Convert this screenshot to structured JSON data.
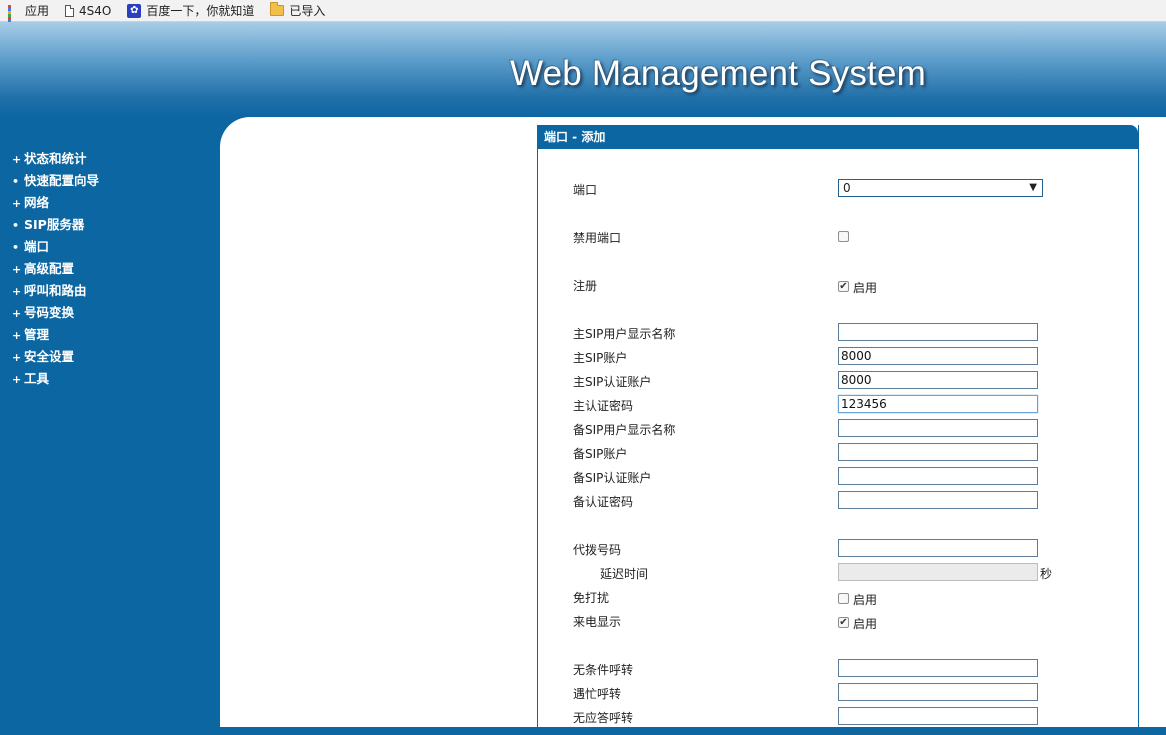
{
  "bookmarks": [
    {
      "label": "应用",
      "icon": "apps-icon"
    },
    {
      "label": "4S4O",
      "icon": "page-icon"
    },
    {
      "label": "百度一下，你就知道",
      "icon": "baidu-paw-icon"
    },
    {
      "label": "已导入",
      "icon": "folder-icon"
    }
  ],
  "header": {
    "title": "Web Management System"
  },
  "nav": {
    "items": [
      {
        "marker": "+",
        "label": "状态和统计"
      },
      {
        "marker": "•",
        "label": "快速配置向导"
      },
      {
        "marker": "+",
        "label": "网络"
      },
      {
        "marker": "•",
        "label": "SIP服务器"
      },
      {
        "marker": "•",
        "label": "端口"
      },
      {
        "marker": "+",
        "label": "高级配置"
      },
      {
        "marker": "+",
        "label": "呼叫和路由"
      },
      {
        "marker": "+",
        "label": "号码变换"
      },
      {
        "marker": "+",
        "label": "管理"
      },
      {
        "marker": "+",
        "label": "安全设置"
      },
      {
        "marker": "+",
        "label": "工具"
      }
    ]
  },
  "panel": {
    "title": "端口 - 添加",
    "port": {
      "label": "端口",
      "value": "0"
    },
    "disable_port": {
      "label": "禁用端口",
      "checked": false
    },
    "register": {
      "label": "注册",
      "checked": true,
      "text": "启用"
    },
    "primary_display_name": {
      "label": "主SIP用户显示名称",
      "value": ""
    },
    "primary_account": {
      "label": "主SIP账户",
      "value": "8000"
    },
    "primary_auth_account": {
      "label": "主SIP认证账户",
      "value": "8000"
    },
    "primary_auth_password": {
      "label": "主认证密码",
      "value": "123456"
    },
    "backup_display_name": {
      "label": "备SIP用户显示名称",
      "value": ""
    },
    "backup_account": {
      "label": "备SIP账户",
      "value": ""
    },
    "backup_auth_account": {
      "label": "备SIP认证账户",
      "value": ""
    },
    "backup_auth_password": {
      "label": "备认证密码",
      "value": ""
    },
    "proxy_number": {
      "label": "代拨号码",
      "value": ""
    },
    "delay_time": {
      "label": "延迟时间",
      "value": "",
      "unit": "秒"
    },
    "dnd": {
      "label": "免打扰",
      "checked": false,
      "text": "启用"
    },
    "caller_id": {
      "label": "来电显示",
      "checked": true,
      "text": "启用"
    },
    "cfu": {
      "label": "无条件呼转",
      "value": ""
    },
    "cfb": {
      "label": "遇忙呼转",
      "value": ""
    },
    "cfnr": {
      "label": "无应答呼转",
      "value": ""
    }
  }
}
